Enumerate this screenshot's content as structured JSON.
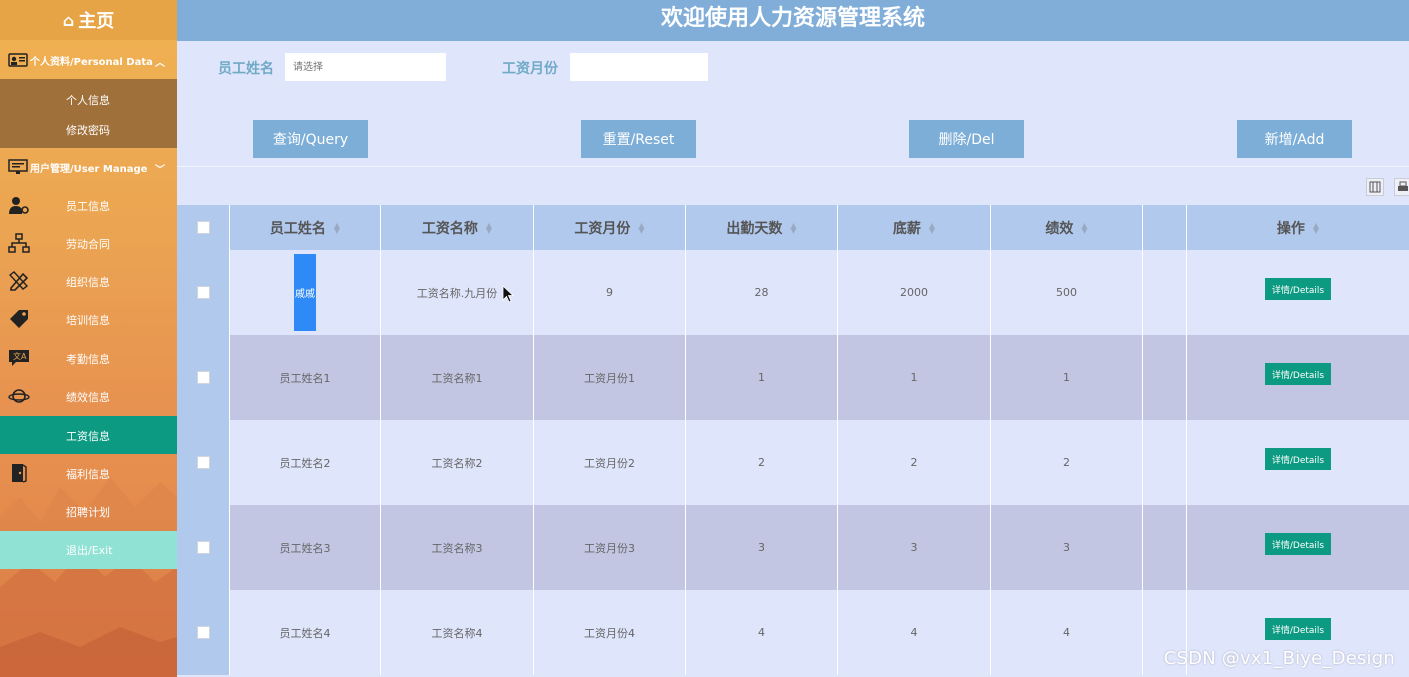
{
  "sidebar": {
    "home_label": "主页",
    "personal_group": "个人资料/Personal Data",
    "personal_items": [
      "个人信息",
      "修改密码"
    ],
    "user_group": "用户管理/User Manage",
    "items": [
      {
        "label": "员工信息",
        "icon": "user-gear-icon"
      },
      {
        "label": "劳动合同",
        "icon": "org-tree-icon"
      },
      {
        "label": "组织信息",
        "icon": "pencil-ruler-icon"
      },
      {
        "label": "培训信息",
        "icon": "tag-icon"
      },
      {
        "label": "考勤信息",
        "icon": "translate-chat-icon"
      },
      {
        "label": "绩效信息",
        "icon": "planet-icon"
      },
      {
        "label": "工资信息",
        "icon": "",
        "active": true
      },
      {
        "label": "福利信息",
        "icon": "door-icon"
      },
      {
        "label": "招聘计划",
        "icon": ""
      }
    ],
    "exit_label": "退出/Exit"
  },
  "header": {
    "title": "欢迎使用人力资源管理系统"
  },
  "search": {
    "name_label": "员工姓名",
    "name_placeholder": "请选择",
    "month_label": "工资月份",
    "month_value": ""
  },
  "buttons": {
    "query": "查询/Query",
    "reset": "重置/Reset",
    "delete": "删除/Del",
    "add": "新增/Add"
  },
  "table": {
    "columns": [
      "员工姓名",
      "工资名称",
      "工资月份",
      "出勤天数",
      "底薪",
      "绩效",
      "",
      "操作"
    ],
    "details_label": "详情/Details",
    "rows": [
      [
        "戚戚",
        "工资名称.九月份",
        "9",
        "28",
        "2000",
        "500"
      ],
      [
        "员工姓名1",
        "工资名称1",
        "工资月份1",
        "1",
        "1",
        "1"
      ],
      [
        "员工姓名2",
        "工资名称2",
        "工资月份2",
        "2",
        "2",
        "2"
      ],
      [
        "员工姓名3",
        "工资名称3",
        "工资月份3",
        "3",
        "3",
        "3"
      ],
      [
        "员工姓名4",
        "工资名称4",
        "工资月份4",
        "4",
        "4",
        "4"
      ]
    ]
  },
  "watermark": "CSDN @vx1_Biye_Design",
  "colors": {
    "sidebar_orange": "#eba452",
    "active_teal": "#0d9a82",
    "header_blue": "#80aed8",
    "button_blue": "#7daed8",
    "name_chip_blue": "#2f89f6"
  }
}
